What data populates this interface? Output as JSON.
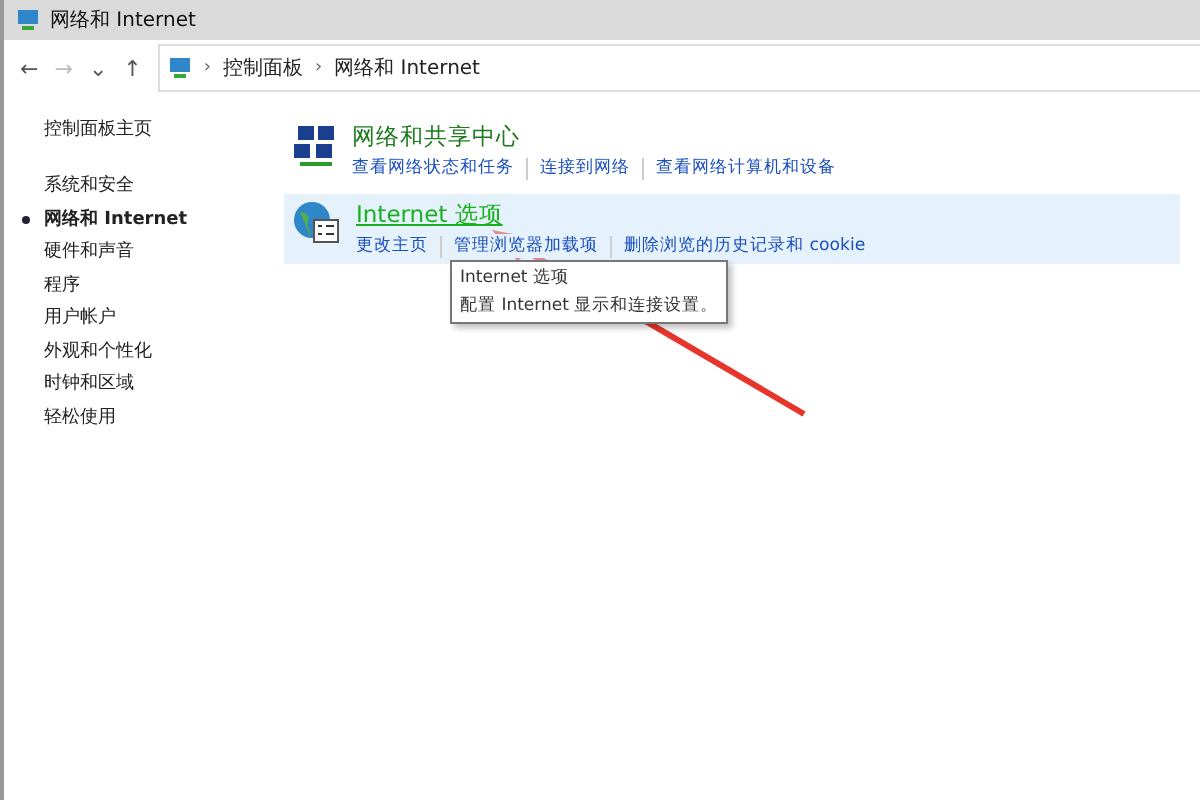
{
  "window": {
    "title": "网络和 Internet"
  },
  "nav": {
    "back": "←",
    "forward": "→",
    "recent": "⌄",
    "up": "↑"
  },
  "address_bar": {
    "separator": "›",
    "crumbs": [
      "控制面板",
      "网络和 Internet"
    ]
  },
  "sidebar": {
    "home": "控制面板主页",
    "items": [
      {
        "label": "系统和安全",
        "selected": false
      },
      {
        "label": "网络和 Internet",
        "selected": true
      },
      {
        "label": "硬件和声音",
        "selected": false
      },
      {
        "label": "程序",
        "selected": false
      },
      {
        "label": "用户帐户",
        "selected": false
      },
      {
        "label": "外观和个性化",
        "selected": false
      },
      {
        "label": "时钟和区域",
        "selected": false
      },
      {
        "label": "轻松使用",
        "selected": false
      }
    ]
  },
  "categories": [
    {
      "kind": "network",
      "title": "网络和共享中心",
      "hovered": false,
      "links": [
        "查看网络状态和任务",
        "连接到网络",
        "查看网络计算机和设备"
      ]
    },
    {
      "kind": "globe",
      "title": "Internet 选项",
      "hovered": true,
      "links": [
        "更改主页",
        "管理浏览器加载项",
        "删除浏览的历史记录和 cookie"
      ]
    }
  ],
  "tooltip": {
    "title": "Internet 选项",
    "text": "配置 Internet 显示和连接设置。"
  }
}
